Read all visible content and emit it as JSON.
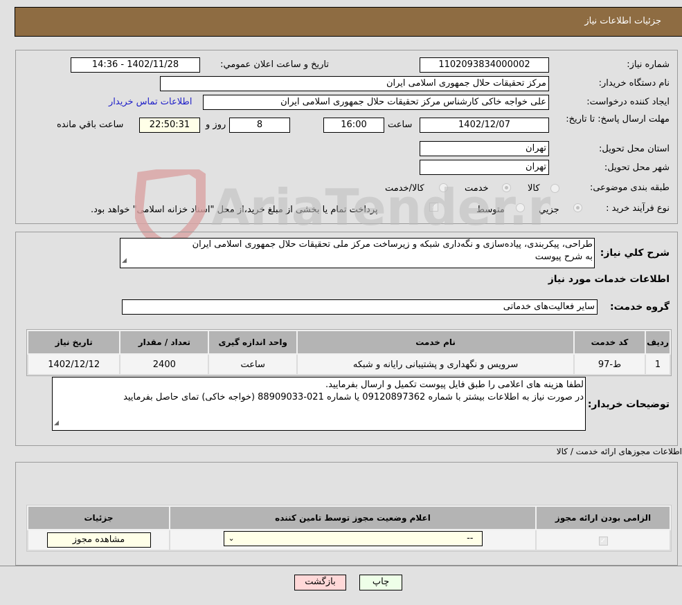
{
  "header": {
    "title": "جزئیات اطلاعات نیاز"
  },
  "info": {
    "need_number_label": "شماره نیاز:",
    "need_number": "1102093834000002",
    "announce_label": "تاریخ و ساعت اعلان عمومي:",
    "announce_value": "1402/11/28 - 14:36",
    "buyer_label": "نام دستگاه خریدار:",
    "buyer_value": "مرکز تحقیقات حلال جمهوری اسلامی ایران",
    "creator_label": "ایجاد کننده درخواست:",
    "creator_value": "علی خواجه خاکی کارشناس مرکز تحقیقات حلال جمهوری اسلامی ایران",
    "contact_link": "اطلاعات تماس خریدار",
    "deadline_label": "مهلت ارسال پاسخ: تا تاریخ:",
    "deadline_date": "1402/12/07",
    "time_label": "ساعت",
    "deadline_time": "16:00",
    "days_value": "8",
    "days_label": "روز و",
    "remaining_value": "22:50:31",
    "remaining_label": "ساعت باقي مانده",
    "province_label": "استان محل تحویل:",
    "province_value": "تهران",
    "city_label": "شهر محل تحویل:",
    "city_value": "تهران",
    "category_label": "طبقه بندی موضوعی:",
    "category_options": [
      {
        "label": "کالا",
        "selected": false
      },
      {
        "label": "خدمت",
        "selected": true
      },
      {
        "label": "کالا/خدمت",
        "selected": false
      }
    ],
    "process_label": "نوع فرآیند خرید :",
    "process_options": [
      {
        "label": "جزيي",
        "selected": true
      },
      {
        "label": "متوسط",
        "selected": false
      }
    ],
    "treasury_text": "پرداخت تمام یا بخشی از مبلغ خرید،از محل \"اسناد خزانه اسلامی\" خواهد بود.",
    "treasury_checked": true
  },
  "description": {
    "label": "شرح كلي نياز:",
    "value_line1": "طراحی، پیکربندی، پیاده‌سازی و نگه‌داری شبکه و زیرساخت مرکز ملی تحقیقات حلال جمهوری اسلامی ایران",
    "value_line2": "به شرح پیوست"
  },
  "services": {
    "section_title": "اطلاعات خدمات مورد نیاز",
    "group_label": "گروه خدمت:",
    "group_value": "سایر فعالیت‌های خدماتی",
    "columns": [
      "ردیف",
      "کد خدمت",
      "نام خدمت",
      "واحد اندازه گیری",
      "تعداد / مقدار",
      "تاریخ نیاز"
    ],
    "rows": [
      {
        "row": "1",
        "code": "ط-97",
        "name": "سرویس و نگهداری و پشتیبانی رایانه و شبکه",
        "unit": "ساعت",
        "qty": "2400",
        "date": "1402/12/12"
      }
    ]
  },
  "buyer_notes": {
    "label": "توضیحات خریدار:",
    "line1": "لطفا هزینه های اعلامی را طبق فایل پیوست تکمیل و ارسال بفرمایید.",
    "line2": "در صورت نیاز به اطلاعات بیشتر با شماره 09120897362 یا شماره 021-88909033 (خواجه خاکی) تمای حاصل بفرمایید"
  },
  "permits": {
    "section_title": "اطلاعات مجوزهای ارائه خدمت / کالا",
    "columns": [
      "الزامی بودن ارائه مجوز",
      "اعلام وضعیت مجوز توسط تامین کننده",
      "جزئیات"
    ],
    "row": {
      "required_checked": true,
      "status_value": "--",
      "details_button": "مشاهده مجوز"
    }
  },
  "buttons": {
    "print": "چاپ",
    "back": "بازگشت"
  },
  "watermark": {
    "text": "AriaTender.neT"
  }
}
